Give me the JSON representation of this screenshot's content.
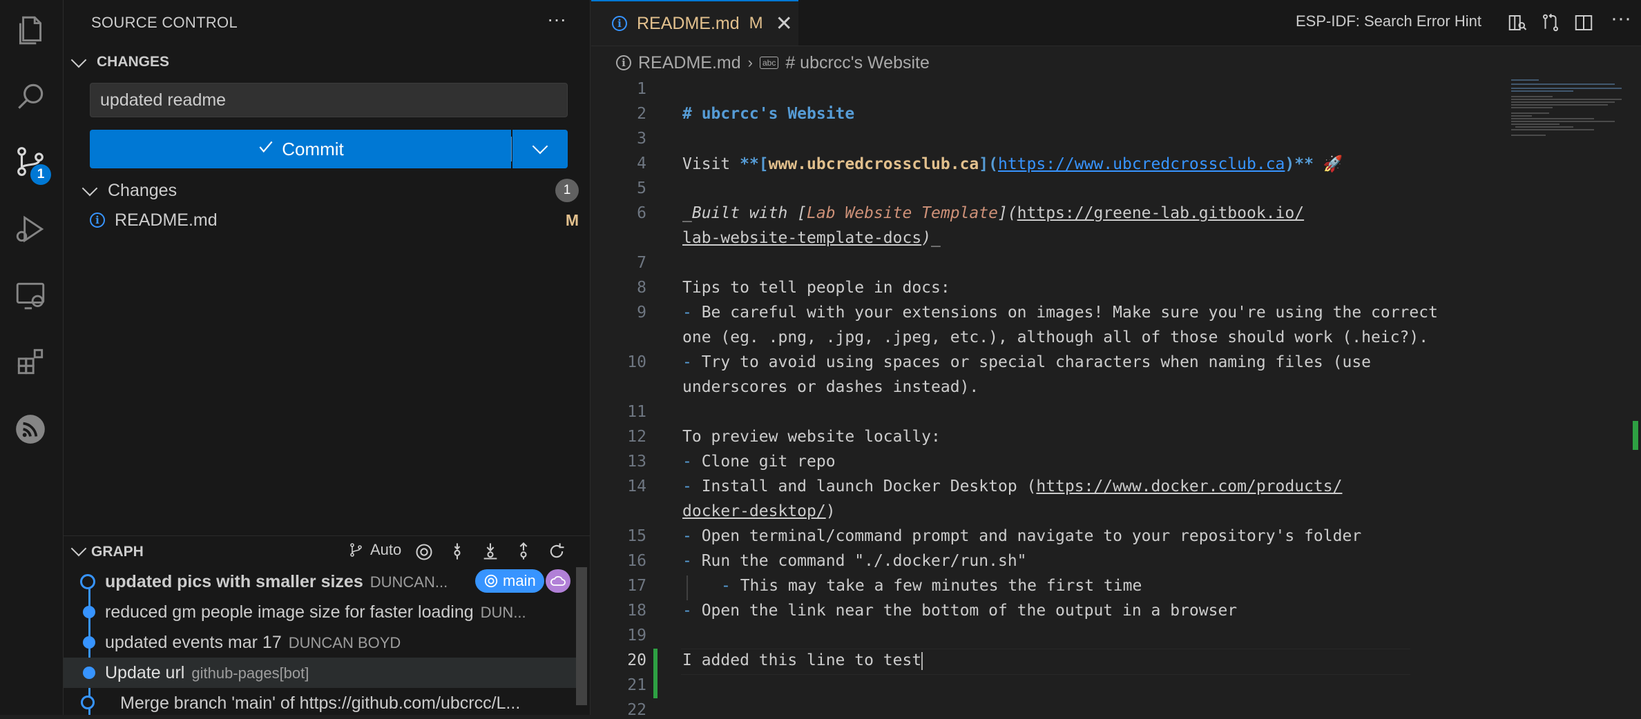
{
  "activity_bar": {
    "icons": [
      "explorer-icon",
      "search-icon",
      "source-control-icon",
      "run-debug-icon",
      "remote-explorer-icon",
      "extensions-icon",
      "esp-idf-icon"
    ],
    "scm_badge": "1"
  },
  "sidebar": {
    "title": "SOURCE CONTROL",
    "more": "···",
    "changes_section": "CHANGES",
    "commit_message": "updated readme",
    "commit_label": "Commit",
    "changes_group": "Changes",
    "changes_count": "1",
    "file": {
      "name": "README.md",
      "status": "M"
    },
    "graph": {
      "title": "GRAPH",
      "auto_label": "Auto",
      "rows": [
        {
          "message": "updated pics with smaller sizes",
          "author": "DUNCAN...",
          "branch": "main"
        },
        {
          "message": "reduced gm people image size for faster loading",
          "author": "DUN..."
        },
        {
          "message": "updated events mar 17",
          "author": "DUNCAN BOYD"
        },
        {
          "message": "Update url",
          "author": "github-pages[bot]"
        },
        {
          "message": "Merge branch 'main' of https://github.com/ubcrcc/L...",
          "author": ""
        }
      ]
    }
  },
  "editor": {
    "tab": {
      "name": "README.md",
      "status": "M"
    },
    "hint": "ESP-IDF: Search Error Hint",
    "breadcrumb": {
      "file": "README.md",
      "symbol": "# ubcrcc's Website",
      "abc": "abc"
    },
    "line_numbers": [
      "1",
      "2",
      "3",
      "4",
      "5",
      "6",
      "7",
      "8",
      "9",
      "10",
      "11",
      "12",
      "13",
      "14",
      "15",
      "16",
      "17",
      "18",
      "19",
      "20",
      "21",
      "22"
    ],
    "text": {
      "l2": "# ubcrcc's Website",
      "l4_visit": "Visit ",
      "l4_open": "**[",
      "l4_site": "www.ubcredcrossclub.ca",
      "l4_mid": "](",
      "l4_url": "https://www.ubcredcrossclub.ca",
      "l4_close": ")**",
      "l4_emoji": " 🚀",
      "l6_a": "_Built with [",
      "l6_b": "Lab Website Template",
      "l6_c": "](",
      "l6_url1": "https://greene-lab.gitbook.io/",
      "l6_url2": "lab-website-template-docs",
      "l6_d": ")_",
      "l8": "Tips to tell people in docs:",
      "l9_dash": "-",
      "l9a": " Be careful with your extensions on images! Make sure you're using the correct",
      "l9b": "one (eg. .png, .jpg, .jpeg, etc.), although all of those should work (.heic?).",
      "l10_dash": "-",
      "l10a": " Try to avoid using spaces or special characters when naming files (use",
      "l10b": "underscores or dashes instead).",
      "l12": "To preview website locally:",
      "l13_dash": "-",
      "l13": " Clone git repo",
      "l14_dash": "-",
      "l14a": " Install and launch Docker Desktop (",
      "l14_url1": "https://www.docker.com/products/",
      "l14_url2": "docker-desktop/",
      "l14_close": ")",
      "l15_dash": "-",
      "l15": " Open terminal/command prompt and navigate to your repository's folder",
      "l16_dash": "-",
      "l16": " Run the command \"./.docker/run.sh\"",
      "l17_dash": "-",
      "l17": " This may take a few minutes the first time",
      "l18_dash": "-",
      "l18": " Open the link near the bottom of the output in a browser",
      "l20": "I added this line to test"
    }
  },
  "colors": {
    "accent": "#0078d4",
    "modified": "#e2c08d",
    "heading": "#569cd6",
    "link": "#3794ff",
    "added": "#2ea043"
  }
}
